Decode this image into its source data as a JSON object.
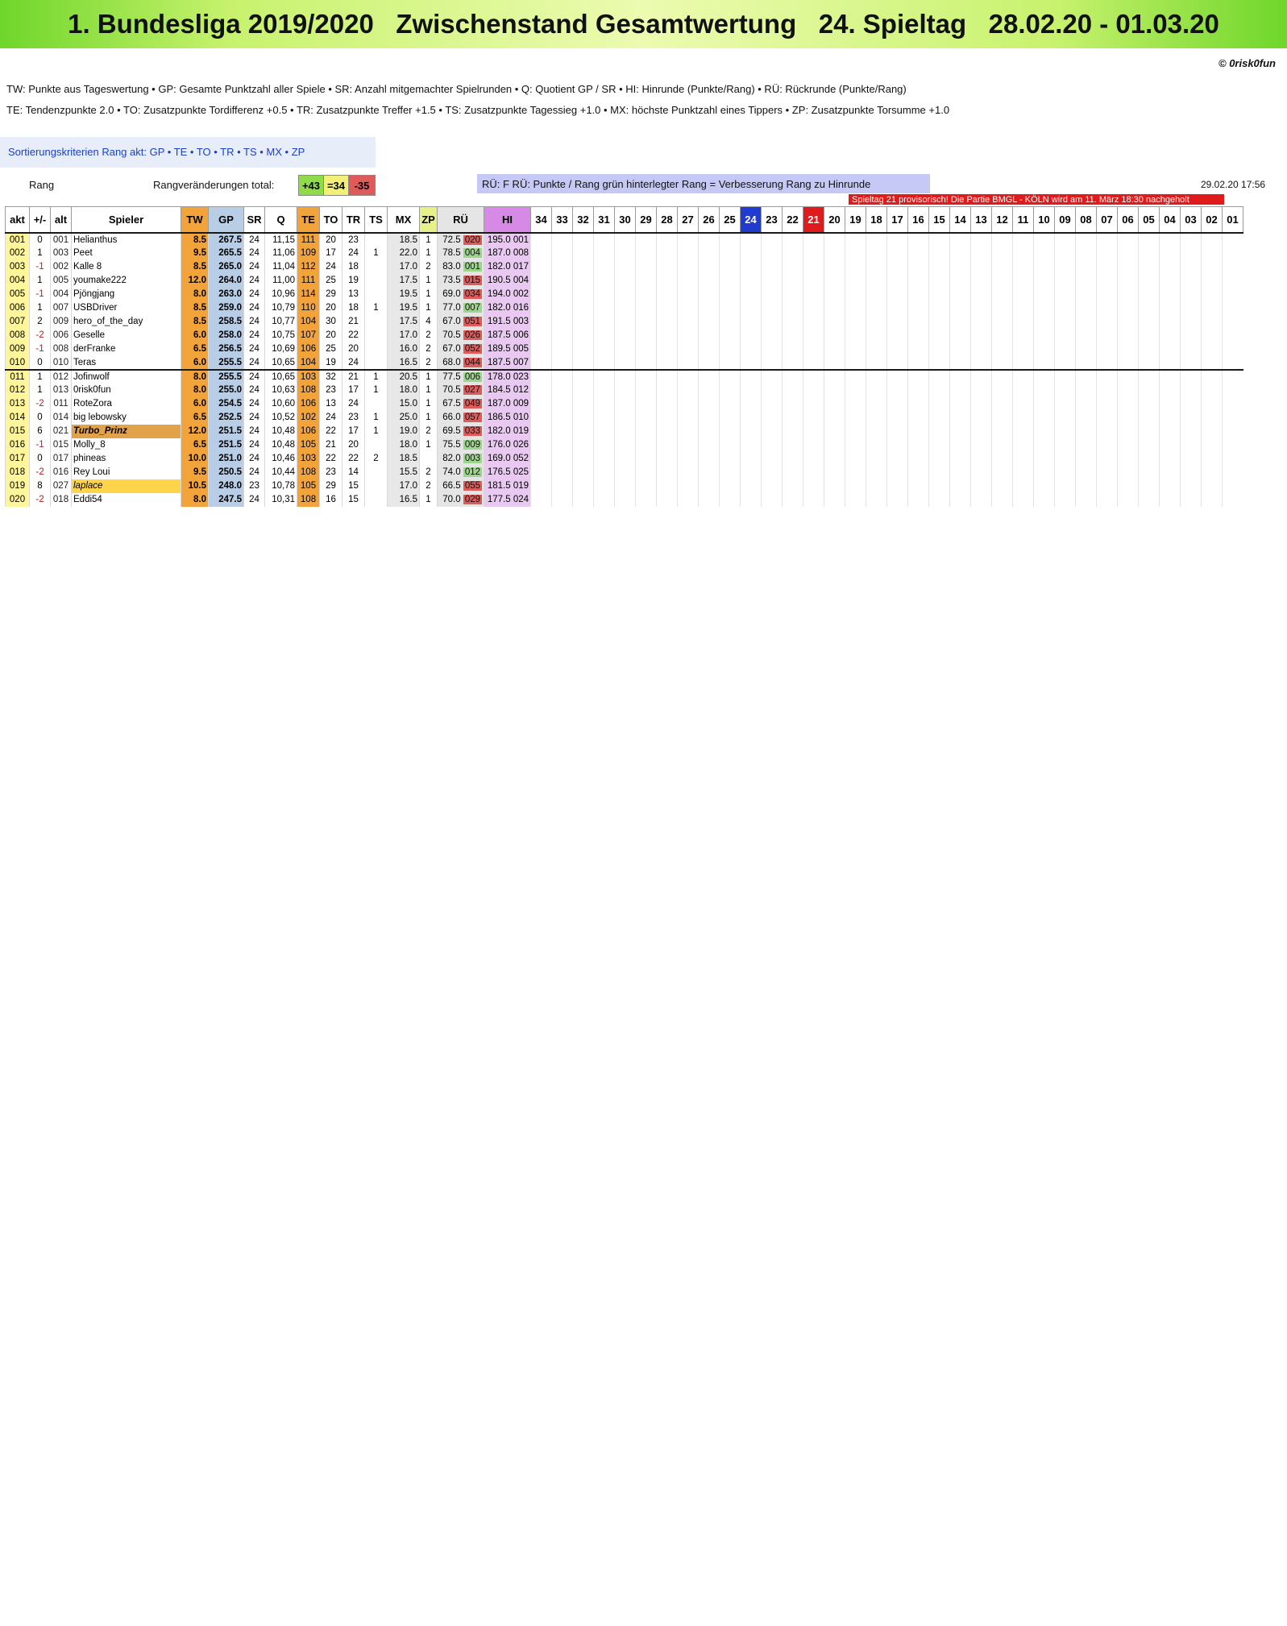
{
  "title": "1. Bundesliga 2019/2020   Zwischenstand Gesamtwertung   24. Spieltag   28.02.20 - 01.03.20",
  "copyright": "© 0risk0fun",
  "legend_line1": "TW:  Punkte aus Tageswertung   •  GP: Gesamte Punktzahl aller Spiele   •  SR: Anzahl mitgemachter Spielrunden   •  Q: Quotient GP / SR   •  HI: Hinrunde (Punkte/Rang)   •  RÜ: Rückrunde (Punkte/Rang)",
  "legend_line2": "TE:  Tendenzpunkte 2.0   •  TO: Zusatzpunkte Tordifferenz +0.5   •  TR: Zusatzpunkte Treffer +1.5   •  TS: Zusatzpunkte Tagessieg +1.0   •  MX: höchste Punktzahl eines Tippers   •  ZP: Zusatzpunkte Torsumme +1.0",
  "sort_criteria": "Sortierungskriterien Rang akt:  GP  •  TE  •  TO  •  TR  •  TS  •  MX  •  ZP",
  "rang_label": "Rang",
  "rangveraenderungen_label": "Rangveränderungen total:",
  "rv": [
    {
      "text": "+43",
      "color": "#8fdb4a"
    },
    {
      "text": "=34",
      "color": "#f3f07a"
    },
    {
      "text": "-35",
      "color": "#e05a5a"
    }
  ],
  "ru_info": "RÜ: F RÜ: Punkte / Rang   grün hinterlegter Rang = Verbesserung Rang zu Hinrunde",
  "datetime": "29.02.20      17:56",
  "notice": "Spieltag 21 provisorisch! Die Partie BMGL - KÖLN wird am 11. März 18:30 nachgeholt",
  "colors": {
    "orange": "#f2a33a",
    "blue_gp": "#b8cde6",
    "green": "#8fdb4a",
    "red": "#e01b1b",
    "purple": "#d68ae6"
  },
  "headers": [
    "akt",
    "+/-",
    "alt",
    "Spieler",
    "TW",
    "GP",
    "SR",
    "Q",
    "TE",
    "TO",
    "TR",
    "TS",
    "MX",
    "ZP",
    "RÜ",
    "HI",
    "34",
    "33",
    "32",
    "31",
    "30",
    "29",
    "28",
    "27",
    "26",
    "25",
    "24",
    "23",
    "22",
    "21",
    "20",
    "19",
    "18",
    "17",
    "16",
    "15",
    "14",
    "13",
    "12",
    "11",
    "10",
    "09",
    "08",
    "07",
    "06",
    "05",
    "04",
    "03",
    "02",
    "01"
  ],
  "rows": [
    [
      "001",
      "0",
      "001",
      "Helianthus",
      "8.5",
      "267.5",
      "24",
      "11,15",
      "111",
      "20",
      "23",
      "",
      "18.5",
      "1",
      "72.5",
      "020",
      "195.0",
      "001"
    ],
    [
      "002",
      "1",
      "003",
      "Peet",
      "9.5",
      "265.5",
      "24",
      "11,06",
      "109",
      "17",
      "24",
      "1",
      "22.0",
      "1",
      "78.5",
      "004",
      "187.0",
      "008"
    ],
    [
      "003",
      "-1",
      "002",
      "Kalle 8",
      "8.5",
      "265.0",
      "24",
      "11,04",
      "112",
      "24",
      "18",
      "",
      "17.0",
      "2",
      "83.0",
      "001",
      "182.0",
      "017"
    ],
    [
      "004",
      "1",
      "005",
      "youmake222",
      "12.0",
      "264.0",
      "24",
      "11,00",
      "111",
      "25",
      "19",
      "",
      "17.5",
      "1",
      "73.5",
      "015",
      "190.5",
      "004"
    ],
    [
      "005",
      "-1",
      "004",
      "Pjöngjang",
      "8.0",
      "263.0",
      "24",
      "10,96",
      "114",
      "29",
      "13",
      "",
      "19.5",
      "1",
      "69.0",
      "034",
      "194.0",
      "002"
    ],
    [
      "006",
      "1",
      "007",
      "USBDriver",
      "8.5",
      "259.0",
      "24",
      "10,79",
      "110",
      "20",
      "18",
      "1",
      "19.5",
      "1",
      "77.0",
      "007",
      "182.0",
      "016"
    ],
    [
      "007",
      "2",
      "009",
      "hero_of_the_day",
      "8.5",
      "258.5",
      "24",
      "10,77",
      "104",
      "30",
      "21",
      "",
      "17.5",
      "4",
      "67.0",
      "051",
      "191.5",
      "003"
    ],
    [
      "008",
      "-2",
      "006",
      "Geselle",
      "6.0",
      "258.0",
      "24",
      "10,75",
      "107",
      "20",
      "22",
      "",
      "17.0",
      "2",
      "70.5",
      "026",
      "187.5",
      "006"
    ],
    [
      "009",
      "-1",
      "008",
      "derFranke",
      "6.5",
      "256.5",
      "24",
      "10,69",
      "106",
      "25",
      "20",
      "",
      "16.0",
      "2",
      "67.0",
      "052",
      "189.5",
      "005"
    ],
    [
      "010",
      "0",
      "010",
      "Teras",
      "6.0",
      "255.5",
      "24",
      "10,65",
      "104",
      "19",
      "24",
      "",
      "16.5",
      "2",
      "68.0",
      "044",
      "187.5",
      "007"
    ],
    [
      "011",
      "1",
      "012",
      "Jofinwolf",
      "8.0",
      "255.5",
      "24",
      "10,65",
      "103",
      "32",
      "21",
      "1",
      "20.5",
      "1",
      "77.5",
      "006",
      "178.0",
      "023"
    ],
    [
      "012",
      "1",
      "013",
      "0risk0fun",
      "8.0",
      "255.0",
      "24",
      "10,63",
      "108",
      "23",
      "17",
      "1",
      "18.0",
      "1",
      "70.5",
      "027",
      "184.5",
      "012"
    ],
    [
      "013",
      "-2",
      "011",
      "RoteZora",
      "6.0",
      "254.5",
      "24",
      "10,60",
      "106",
      "13",
      "24",
      "",
      "15.0",
      "1",
      "67.5",
      "049",
      "187.0",
      "009"
    ],
    [
      "014",
      "0",
      "014",
      "big lebowsky",
      "6.5",
      "252.5",
      "24",
      "10,52",
      "102",
      "24",
      "23",
      "1",
      "25.0",
      "1",
      "66.0",
      "057",
      "186.5",
      "010"
    ],
    [
      "015",
      "6",
      "021",
      "Turbo_Prinz",
      "12.0",
      "251.5",
      "24",
      "10,48",
      "106",
      "22",
      "17",
      "1",
      "19.0",
      "2",
      "69.5",
      "033",
      "182.0",
      "019"
    ],
    [
      "016",
      "-1",
      "015",
      "Molly_8",
      "6.5",
      "251.5",
      "24",
      "10,48",
      "105",
      "21",
      "20",
      "",
      "18.0",
      "1",
      "75.5",
      "009",
      "176.0",
      "026"
    ],
    [
      "017",
      "0",
      "017",
      "phineas",
      "10.0",
      "251.0",
      "24",
      "10,46",
      "103",
      "22",
      "22",
      "2",
      "18.5",
      "",
      "82.0",
      "003",
      "169.0",
      "052"
    ],
    [
      "018",
      "-2",
      "016",
      "Rey Loui",
      "9.5",
      "250.5",
      "24",
      "10,44",
      "108",
      "23",
      "14",
      "",
      "15.5",
      "2",
      "74.0",
      "012",
      "176.5",
      "025"
    ],
    [
      "019",
      "8",
      "027",
      "laplace",
      "10.5",
      "248.0",
      "23",
      "10,78",
      "105",
      "29",
      "15",
      "",
      "17.0",
      "2",
      "66.5",
      "055",
      "181.5",
      "019"
    ],
    [
      "020",
      "-2",
      "018",
      "Eddi54",
      "8.0",
      "247.5",
      "24",
      "10,31",
      "108",
      "16",
      "15",
      "",
      "16.5",
      "1",
      "70.0",
      "029",
      "177.5",
      "024"
    ]
  ],
  "row_classes": [
    "grp",
    "",
    "",
    "",
    "",
    "",
    "",
    "",
    "",
    "",
    "grp",
    "",
    "",
    "",
    "",
    "",
    "",
    "",
    "",
    ""
  ],
  "highlight_names": [
    "",
    "",
    "",
    "",
    "",
    "",
    "",
    "",
    "",
    "",
    "",
    "",
    "",
    "",
    "orange",
    "",
    "",
    "",
    "yellow",
    ""
  ]
}
